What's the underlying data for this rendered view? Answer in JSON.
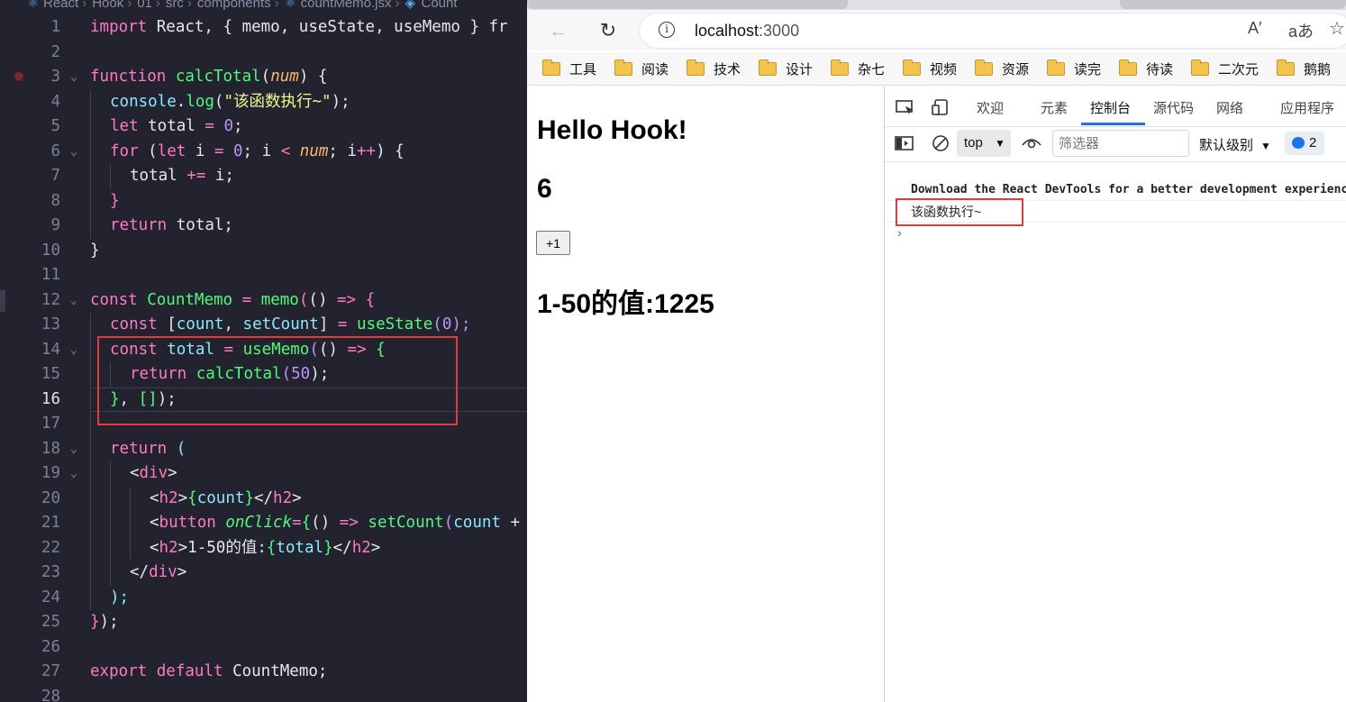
{
  "editor": {
    "breadcrumb": [
      "React",
      "Hook",
      "01",
      "src",
      "components",
      "countMemo.jsx",
      "Count"
    ],
    "lines": [
      {
        "num": "1"
      },
      {
        "num": "2"
      },
      {
        "num": "3"
      },
      {
        "num": "4"
      },
      {
        "num": "5"
      },
      {
        "num": "6"
      },
      {
        "num": "7"
      },
      {
        "num": "8"
      },
      {
        "num": "9"
      },
      {
        "num": "10"
      },
      {
        "num": "11"
      },
      {
        "num": "12"
      },
      {
        "num": "13"
      },
      {
        "num": "14"
      },
      {
        "num": "15"
      },
      {
        "num": "16"
      },
      {
        "num": "17"
      },
      {
        "num": "18"
      },
      {
        "num": "19"
      },
      {
        "num": "20"
      },
      {
        "num": "21"
      },
      {
        "num": "22"
      },
      {
        "num": "23"
      },
      {
        "num": "24"
      },
      {
        "num": "25"
      },
      {
        "num": "26"
      },
      {
        "num": "27"
      },
      {
        "num": "28"
      }
    ],
    "code": {
      "l1": [
        "import",
        " React, { memo, useState, useMemo } ",
        "fr"
      ],
      "l3": [
        "function",
        " ",
        "calcTotal",
        "(",
        "num",
        ") {"
      ],
      "l4": [
        "console",
        ".",
        "log",
        "(",
        "\"该函数执行~\"",
        ");"
      ],
      "l5": [
        "let",
        " total ",
        "=",
        " ",
        "0",
        ";"
      ],
      "l6": [
        "for",
        " (",
        "let",
        " i ",
        "=",
        " ",
        "0",
        "; i ",
        "<",
        " ",
        "num",
        "; i",
        "++",
        ") {"
      ],
      "l7": [
        "total ",
        "+=",
        " i;"
      ],
      "l8": [
        "}"
      ],
      "l9": [
        "return",
        " total;"
      ],
      "l10": [
        "}"
      ],
      "l12": [
        "const",
        " ",
        "CountMemo",
        " ",
        "=",
        " ",
        "memo",
        "(",
        "() ",
        "=>",
        " {"
      ],
      "l13": [
        "const",
        " [",
        "count",
        ", ",
        "setCount",
        "] ",
        "=",
        " ",
        "useState",
        "(",
        "0",
        ");"
      ],
      "l14": [
        "const",
        " ",
        "total",
        " ",
        "=",
        " ",
        "useMemo",
        "(",
        "() ",
        "=>",
        " {"
      ],
      "l15": [
        "return",
        " ",
        "calcTotal",
        "(",
        "50",
        ");"
      ],
      "l16": [
        "}",
        ", ",
        "[]",
        ");"
      ],
      "l18": [
        "return",
        " ("
      ],
      "l19": [
        "<",
        "div",
        ">"
      ],
      "l20": [
        "<",
        "h2",
        ">",
        "{",
        "count",
        "}",
        "</",
        "h2",
        ">"
      ],
      "l21": [
        "<",
        "button",
        " ",
        "onClick",
        "=",
        "{",
        "() ",
        "=>",
        " ",
        "setCount",
        "(",
        "count",
        " +"
      ],
      "l22": [
        "<",
        "h2",
        ">",
        "1-50的值:",
        "{",
        "total",
        "}",
        "</",
        "h2",
        ">"
      ],
      "l23": [
        "</",
        "div",
        ">"
      ],
      "l24": [
        ");"
      ],
      "l25": [
        "}",
        ");"
      ],
      "l27": [
        "export",
        " ",
        "default",
        " CountMemo;"
      ]
    }
  },
  "browser": {
    "url_host": "localhost",
    "url_port": ":3000",
    "read_aloud": "A′",
    "translate": "aあ",
    "bookmarks": [
      "工具",
      "阅读",
      "技术",
      "设计",
      "杂七",
      "视频",
      "资源",
      "读完",
      "待读",
      "二次元",
      "鹅鹅"
    ],
    "page": {
      "title": "Hello Hook!",
      "count": "6",
      "button_label": "+1",
      "total_text": "1-50的值:1225"
    },
    "devtools": {
      "tabs": [
        "欢迎",
        "元素",
        "控制台",
        "源代码",
        "网络",
        "应用程序"
      ],
      "context": "top",
      "filter_placeholder": "筛选器",
      "level": "默认级别",
      "issues_count": "2",
      "messages": [
        "Download the React DevTools for a better development experience",
        "该函数执行~"
      ],
      "prompt": "›"
    }
  }
}
